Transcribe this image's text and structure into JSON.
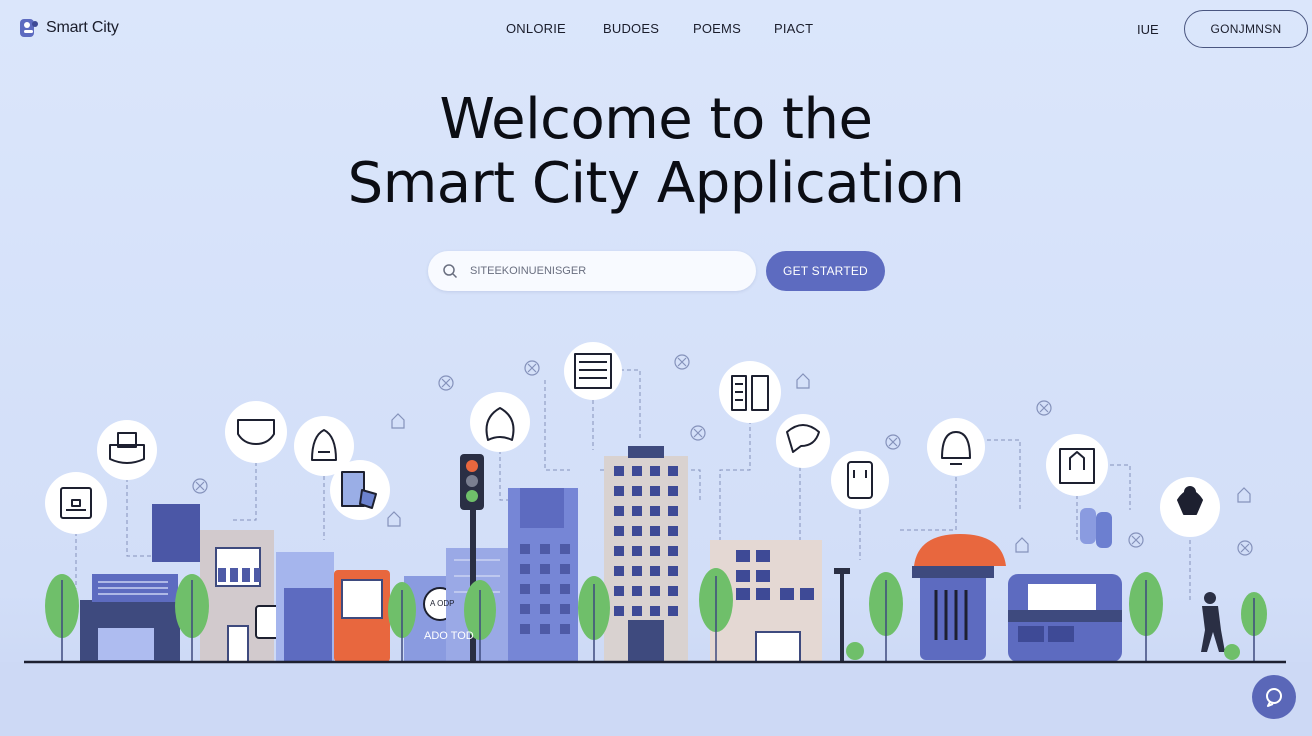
{
  "brand": {
    "name": "Smart City"
  },
  "nav": {
    "items": [
      "ONLORIE",
      "BUDOES",
      "POEMS",
      "PIACT"
    ]
  },
  "header": {
    "lang": "IUE",
    "cta_label": "GONJMNSN"
  },
  "hero": {
    "line1": "Welcome to the",
    "line2": "Smart City Application"
  },
  "search": {
    "placeholder": "SITEEKOINUENISGER",
    "cta_label": "GET STARTED"
  },
  "illustration": {
    "bus_sign": "ADO TOD",
    "signal_sign": "A ODP",
    "small_sign": "▲"
  },
  "colors": {
    "background": "#d6e2fa",
    "primary": "#5d6bc0",
    "accent": "#e8673e",
    "tree": "#6fbf6a"
  },
  "icons": [
    "app-logo-icon",
    "search-icon",
    "chat-help-icon",
    "traffic-light-icon",
    "city-icon-bubble"
  ]
}
